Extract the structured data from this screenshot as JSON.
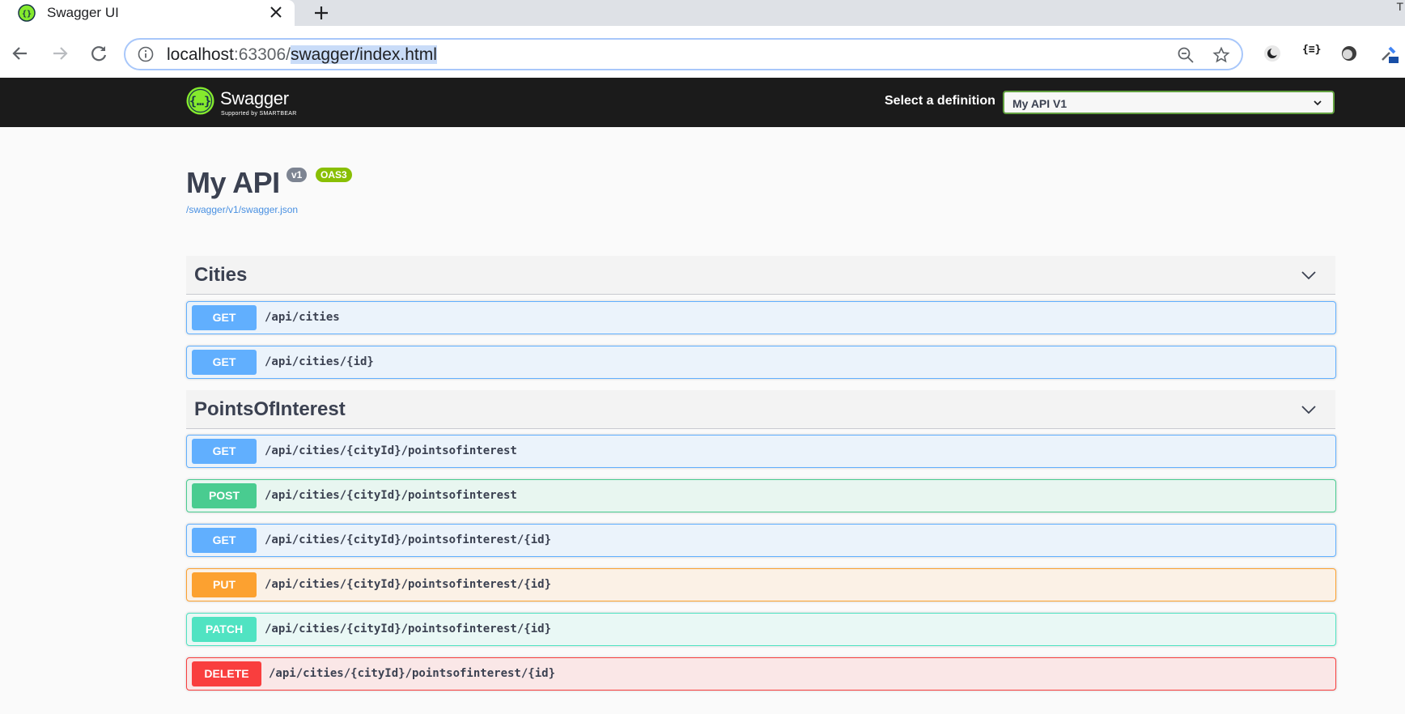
{
  "browser": {
    "tab_title": "Swagger UI",
    "url_host": "localhost",
    "url_port": ":63306/",
    "url_path": "swagger/index.html",
    "tab_overflow_glyph": "T"
  },
  "extensions": [
    "dark-mode-icon",
    "json-viewer-icon",
    "circle-icon",
    "eyedropper-icon"
  ],
  "json_viewer_label": "{≡}",
  "topbar": {
    "logo_text": "Swagger",
    "logo_sub": "Supported by SMARTBEAR",
    "definition_label": "Select a definition",
    "definition_value": "My API V1"
  },
  "info": {
    "title": "My API",
    "version_badge": "v1",
    "oas_badge": "OAS3",
    "spec_link": "/swagger/v1/swagger.json"
  },
  "tags": [
    {
      "name": "Cities",
      "operations": [
        {
          "method": "GET",
          "path": "/api/cities"
        },
        {
          "method": "GET",
          "path": "/api/cities/{id}"
        }
      ]
    },
    {
      "name": "PointsOfInterest",
      "operations": [
        {
          "method": "GET",
          "path": "/api/cities/{cityId}/pointsofinterest"
        },
        {
          "method": "POST",
          "path": "/api/cities/{cityId}/pointsofinterest"
        },
        {
          "method": "GET",
          "path": "/api/cities/{cityId}/pointsofinterest/{id}"
        },
        {
          "method": "PUT",
          "path": "/api/cities/{cityId}/pointsofinterest/{id}"
        },
        {
          "method": "PATCH",
          "path": "/api/cities/{cityId}/pointsofinterest/{id}"
        },
        {
          "method": "DELETE",
          "path": "/api/cities/{cityId}/pointsofinterest/{id}"
        }
      ]
    }
  ],
  "colors": {
    "get": "#61affe",
    "post": "#49cc90",
    "put": "#fca130",
    "patch": "#50e3c2",
    "delete": "#f93e3e",
    "oas_badge": "#89bf04",
    "topbar": "#1b1b1b"
  }
}
